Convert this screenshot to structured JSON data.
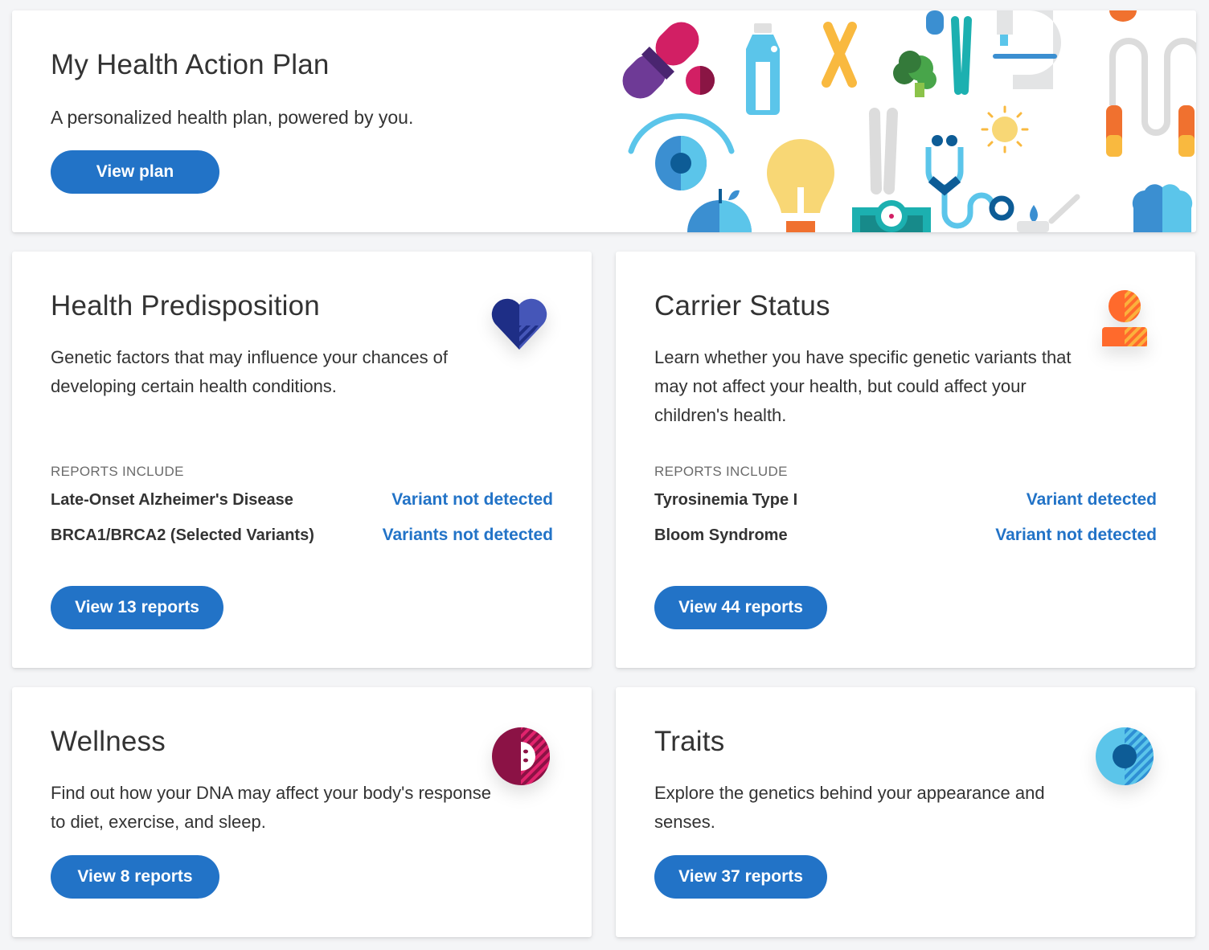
{
  "hero": {
    "title": "My Health Action Plan",
    "subtitle": "A personalized health plan, powered by you.",
    "button_label": "View plan",
    "illustration": "health-icons-collage"
  },
  "cards": [
    {
      "id": "health-predisposition",
      "title": "Health Predisposition",
      "description": "Genetic factors that may influence your chances of developing certain health conditions.",
      "icon": "heart-icon",
      "reports_label": "REPORTS INCLUDE",
      "reports": [
        {
          "name": "Late-Onset Alzheimer's Disease",
          "status": "Variant not detected"
        },
        {
          "name": "BRCA1/BRCA2 (Selected Variants)",
          "status": "Variants not detected"
        }
      ],
      "button_label": "View 13 reports"
    },
    {
      "id": "carrier-status",
      "title": "Carrier Status",
      "description": "Learn whether you have specific genetic variants that may not affect your health, but could affect your children's health.",
      "icon": "person-icon",
      "reports_label": "REPORTS INCLUDE",
      "reports": [
        {
          "name": "Tyrosinemia Type I",
          "status": "Variant detected"
        },
        {
          "name": "Bloom Syndrome",
          "status": "Variant not detected"
        }
      ],
      "button_label": "View 44 reports"
    },
    {
      "id": "wellness",
      "title": "Wellness",
      "description": "Find out how your DNA may affect your body's response to diet, exercise, and sleep.",
      "icon": "wellness-plate-icon",
      "button_label": "View 8 reports"
    },
    {
      "id": "traits",
      "title": "Traits",
      "description": "Explore the genetics behind your appearance and senses.",
      "icon": "eye-icon",
      "button_label": "View 37 reports"
    }
  ],
  "colors": {
    "accent": "#2273c7",
    "text": "#333333",
    "muted": "#6b6b6b",
    "background": "#f4f5f7"
  }
}
